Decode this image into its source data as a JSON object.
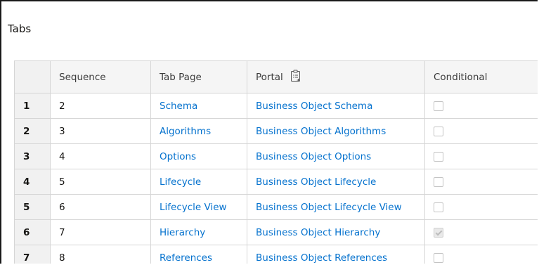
{
  "panel": {
    "title": "Tabs"
  },
  "table": {
    "columns": [
      "",
      "Sequence",
      "Tab Page",
      "Portal",
      "Conditional"
    ],
    "rows": [
      {
        "num": "1",
        "sequence": "2",
        "tab_page": "Schema",
        "portal": "Business Object Schema",
        "conditional": false
      },
      {
        "num": "2",
        "sequence": "3",
        "tab_page": "Algorithms",
        "portal": "Business Object Algorithms",
        "conditional": false
      },
      {
        "num": "3",
        "sequence": "4",
        "tab_page": "Options",
        "portal": "Business Object Options",
        "conditional": false
      },
      {
        "num": "4",
        "sequence": "5",
        "tab_page": "Lifecycle",
        "portal": "Business Object Lifecycle",
        "conditional": false
      },
      {
        "num": "5",
        "sequence": "6",
        "tab_page": "Lifecycle View",
        "portal": "Business Object Lifecycle View",
        "conditional": false
      },
      {
        "num": "6",
        "sequence": "7",
        "tab_page": "Hierarchy",
        "portal": "Business Object Hierarchy",
        "conditional": true
      },
      {
        "num": "7",
        "sequence": "8",
        "tab_page": "References",
        "portal": "Business Object References",
        "conditional": false
      }
    ]
  },
  "icons": {
    "portal_header": "clipboard-list-icon"
  },
  "colors": {
    "link": "#0572ce",
    "header_bg": "#f5f5f5",
    "border": "#d6d6d6"
  }
}
